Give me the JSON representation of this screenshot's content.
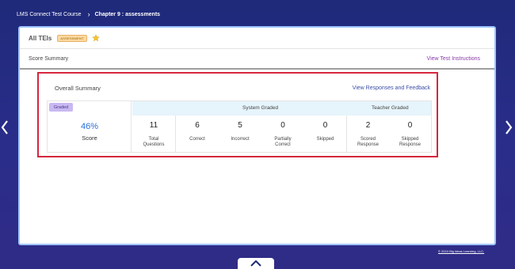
{
  "breadcrumb": {
    "course": "LMS Connect Test Course",
    "chapter": "Chapter 9 : assessments"
  },
  "panel": {
    "title": "All TEIs",
    "tag": "ASSESSMENT",
    "subheader_label": "Score Summary",
    "instructions_link": "View Test Instructions"
  },
  "summary": {
    "title": "Overall Summary",
    "responses_link": "View Responses and Feedback",
    "badge": "Graded",
    "score_value": "46%",
    "score_label": "Score",
    "groups": {
      "system": "System Graded",
      "teacher": "Teacher Graded"
    },
    "metrics": [
      {
        "value": "11",
        "label_lines": [
          "Total",
          "Questions"
        ]
      },
      {
        "value": "6",
        "label_lines": [
          "Correct"
        ]
      },
      {
        "value": "5",
        "label_lines": [
          "Incorrect"
        ]
      },
      {
        "value": "0",
        "label_lines": [
          "Partially",
          "Correct"
        ]
      },
      {
        "value": "0",
        "label_lines": [
          "Skipped"
        ]
      },
      {
        "value": "2",
        "label_lines": [
          "Scored",
          "Response"
        ]
      },
      {
        "value": "0",
        "label_lines": [
          "Skipped",
          "Response"
        ]
      }
    ]
  },
  "footer": {
    "copyright": "© 2024 Big Ideas Learning, LLC."
  },
  "colors": {
    "background": "#2a2d8a",
    "highlight_border": "#d6263c",
    "score_blue": "#2a6fd6",
    "link_purple": "#8a3aa8"
  }
}
